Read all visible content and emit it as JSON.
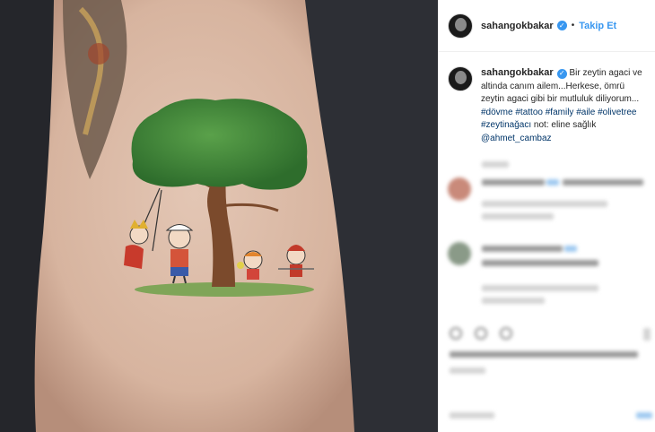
{
  "post": {
    "username": "sahangokbakar",
    "follow_label": "Takip Et",
    "separator": "•",
    "verified_glyph": "✓"
  },
  "caption": {
    "username": "sahangokbakar",
    "text_before": "Bir zeytin agaci ve altinda canım ailem...Herkese, ömrü zeytin agaci gibi bir mutluluk diliyorum... ",
    "tags": [
      "#dövme",
      "#tattoo",
      "#family",
      "#aile",
      "#olivetree",
      "#zeytinağacı"
    ],
    "text_after": " not: eline sağlık ",
    "mention": "@ahmet_cambaz"
  },
  "colors": {
    "accent": "#3897f0",
    "link": "#003569",
    "skin": "#d9b9a6",
    "tree": "#3f8a3b"
  }
}
